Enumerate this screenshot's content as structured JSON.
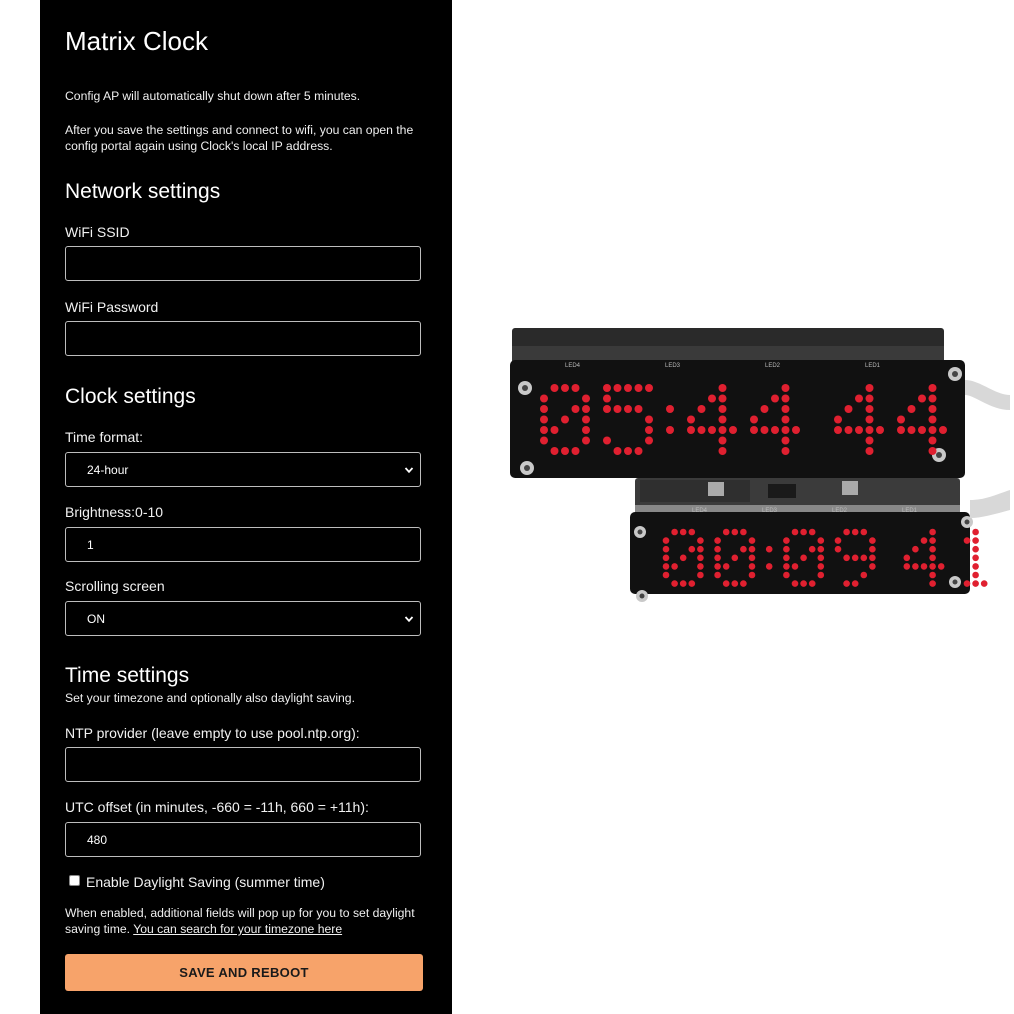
{
  "app": {
    "title": "Matrix Clock",
    "intro_1": "Config AP will automatically shut down after 5 minutes.",
    "intro_2a": "After you save the settings and connect to wifi, you can open the",
    "intro_2b": "config portal again using Clock's local IP address."
  },
  "network": {
    "heading": "Network settings",
    "ssid_label": "WiFi SSID",
    "ssid_value": "",
    "password_label": "WiFi Password",
    "password_value": ""
  },
  "clock": {
    "heading": "Clock settings",
    "time_format_label": "Time format:",
    "time_format_value": "24-hour",
    "brightness_label": "Brightness:0-10",
    "brightness_value": "1",
    "scrolling_label": "Scrolling screen",
    "scrolling_value": "ON"
  },
  "time": {
    "heading": "Time settings",
    "subtitle": "Set your timezone and optionally also daylight saving.",
    "ntp_label": "NTP provider (leave empty to use pool.ntp.org):",
    "ntp_value": "",
    "utc_label": "UTC offset (in minutes, -660 = -11h, 660 = +11h):",
    "utc_value": "480",
    "dst_label": "Enable Daylight Saving (summer time)",
    "dst_checked": false,
    "note_1": "When enabled, additional fields will pop up for you to set daylight",
    "note_2_prefix": "saving time. ",
    "note_link": "You can search for your timezone here"
  },
  "actions": {
    "save_label": "SAVE AND REBOOT"
  },
  "photo": {
    "upper_display": "05:44 44",
    "lower_display": "00:09 41",
    "upper_pcb_labels": [
      "LED4",
      "LED3",
      "LED2",
      "LED1"
    ],
    "lower_pcb_labels": [
      "LED4",
      "LED3",
      "LED2",
      "LED1"
    ],
    "led_color": "#e02030"
  },
  "colors": {
    "panel_bg": "#000000",
    "accent_button": "#f7a36a",
    "text": "#ffffff"
  }
}
